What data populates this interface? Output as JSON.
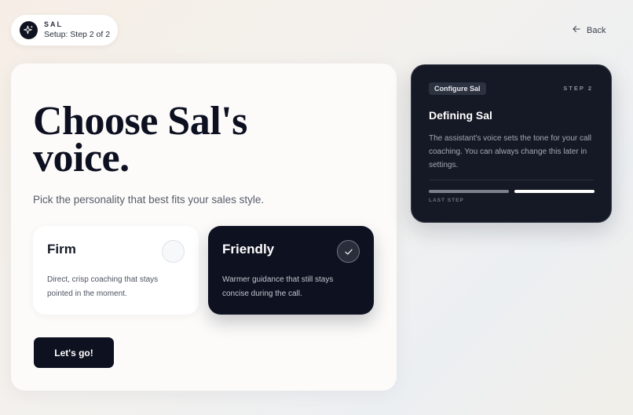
{
  "brand": {
    "name": "SAL",
    "step_label": "Setup: Step 2 of 2",
    "logo_icon": "sparkle-icon"
  },
  "nav": {
    "back_label": "Back",
    "back_icon": "arrow-left-icon"
  },
  "main": {
    "title": "Choose Sal's voice.",
    "subtitle": "Pick the personality that best fits your sales style.",
    "options": [
      {
        "title": "Firm",
        "description": "Direct, crisp coaching that stays pointed in the moment.",
        "selected": false
      },
      {
        "title": "Friendly",
        "description": "Warmer guidance that still stays concise during the call.",
        "selected": true
      }
    ],
    "cta_label": "Let's go!"
  },
  "side": {
    "badge": "Configure Sal",
    "step": "STEP 2",
    "title": "Defining Sal",
    "description": "The assistant's voice sets the tone for your call coaching. You can always change this later in settings.",
    "progress": {
      "current": 2,
      "total": 2
    },
    "progress_caption": "LAST STEP"
  },
  "colors": {
    "dark": "#0d1120",
    "panel": "#151925",
    "accent_white": "#ffffff"
  }
}
